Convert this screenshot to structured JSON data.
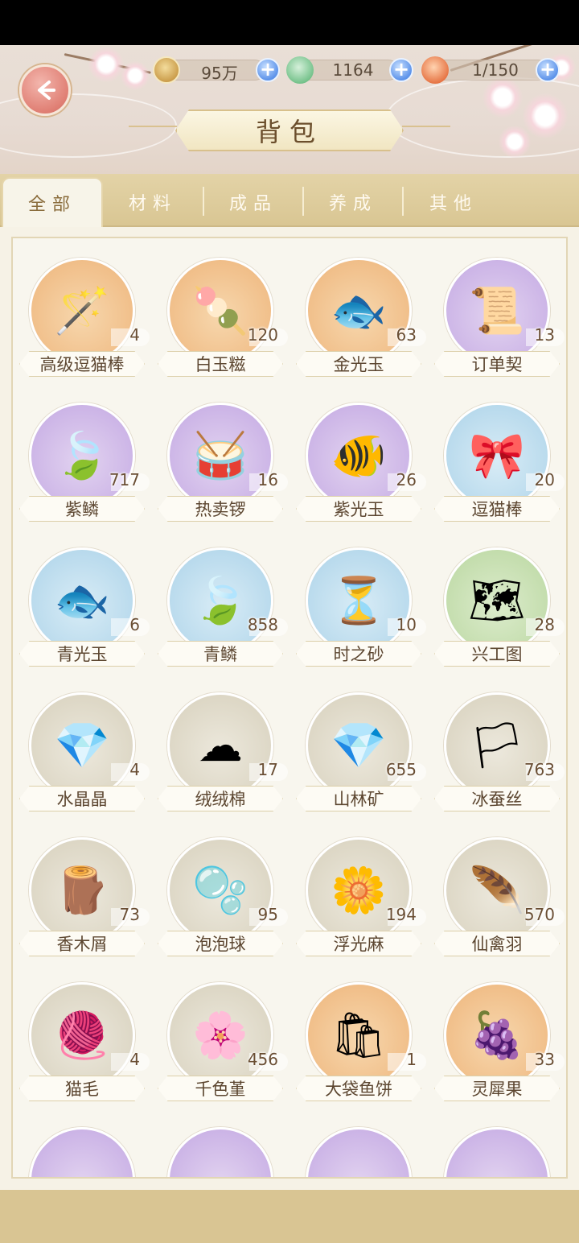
{
  "header": {
    "title": "背包",
    "resources": [
      {
        "name": "paw-coin",
        "value": "95万",
        "icon": "paw-coin-icon"
      },
      {
        "name": "jade",
        "value": "1164",
        "icon": "jade-icon"
      },
      {
        "name": "capacity",
        "value": "1/150",
        "icon": "bag-icon"
      }
    ],
    "plus_label": "+"
  },
  "tabs": [
    {
      "label": "全部",
      "active": true
    },
    {
      "label": "材料",
      "active": false
    },
    {
      "label": "成品",
      "active": false
    },
    {
      "label": "养成",
      "active": false
    },
    {
      "label": "其他",
      "active": false
    }
  ],
  "items": [
    {
      "name": "高级逗猫棒",
      "count": "4",
      "bg": "orange",
      "icon": "cat-teaser-icon",
      "glyph": "🪄"
    },
    {
      "name": "白玉糍",
      "count": "120",
      "bg": "orange",
      "icon": "rice-cake-icon",
      "glyph": "🍡"
    },
    {
      "name": "金光玉",
      "count": "63",
      "bg": "orange",
      "icon": "gold-jade-fish-icon",
      "glyph": "🐟"
    },
    {
      "name": "订单契",
      "count": "13",
      "bg": "purple",
      "icon": "contract-scroll-icon",
      "glyph": "📜"
    },
    {
      "name": "紫鳞",
      "count": "717",
      "bg": "purple",
      "icon": "purple-scale-icon",
      "glyph": "🍃"
    },
    {
      "name": "热卖锣",
      "count": "16",
      "bg": "purple",
      "icon": "gong-icon",
      "glyph": "🥁"
    },
    {
      "name": "紫光玉",
      "count": "26",
      "bg": "purple",
      "icon": "purple-jade-fish-icon",
      "glyph": "🐠"
    },
    {
      "name": "逗猫棒",
      "count": "20",
      "bg": "blue",
      "icon": "feather-wand-icon",
      "glyph": "🎀"
    },
    {
      "name": "青光玉",
      "count": "6",
      "bg": "blue",
      "icon": "cyan-jade-fish-icon",
      "glyph": "🐟"
    },
    {
      "name": "青鳞",
      "count": "858",
      "bg": "blue",
      "icon": "green-scale-icon",
      "glyph": "🍃"
    },
    {
      "name": "时之砂",
      "count": "10",
      "bg": "blue",
      "icon": "hourglass-icon",
      "glyph": "⏳"
    },
    {
      "name": "兴工图",
      "count": "28",
      "bg": "green",
      "icon": "blueprint-scroll-icon",
      "glyph": "🗺"
    },
    {
      "name": "水晶晶",
      "count": "4",
      "bg": "grey",
      "icon": "crystal-icon",
      "glyph": "💎"
    },
    {
      "name": "绒绒棉",
      "count": "17",
      "bg": "grey",
      "icon": "cotton-icon",
      "glyph": "☁"
    },
    {
      "name": "山林矿",
      "count": "655",
      "bg": "grey",
      "icon": "ore-icon",
      "glyph": "💎"
    },
    {
      "name": "冰蚕丝",
      "count": "763",
      "bg": "grey",
      "icon": "silk-icon",
      "glyph": "🏳"
    },
    {
      "name": "香木屑",
      "count": "73",
      "bg": "grey",
      "icon": "wood-log-icon",
      "glyph": "🪵"
    },
    {
      "name": "泡泡球",
      "count": "95",
      "bg": "grey",
      "icon": "bubble-icon",
      "glyph": "🫧"
    },
    {
      "name": "浮光麻",
      "count": "194",
      "bg": "grey",
      "icon": "golden-flower-icon",
      "glyph": "🌼"
    },
    {
      "name": "仙禽羽",
      "count": "570",
      "bg": "grey",
      "icon": "feather-icon",
      "glyph": "🪶"
    },
    {
      "name": "猫毛",
      "count": "4",
      "bg": "grey",
      "icon": "cat-fur-icon",
      "glyph": "🧶"
    },
    {
      "name": "千色堇",
      "count": "456",
      "bg": "grey",
      "icon": "pansy-icon",
      "glyph": "🌸"
    },
    {
      "name": "大袋鱼饼",
      "count": "1",
      "bg": "orange",
      "icon": "fish-cracker-bag-icon",
      "glyph": "🛍"
    },
    {
      "name": "灵犀果",
      "count": "33",
      "bg": "orange",
      "icon": "golden-fruit-icon",
      "glyph": "🍇"
    },
    {
      "name": "",
      "count": "",
      "bg": "purple",
      "icon": "partial-item-icon",
      "glyph": ""
    },
    {
      "name": "",
      "count": "",
      "bg": "purple",
      "icon": "partial-item-icon",
      "glyph": ""
    },
    {
      "name": "",
      "count": "",
      "bg": "purple",
      "icon": "partial-item-icon",
      "glyph": ""
    },
    {
      "name": "",
      "count": "",
      "bg": "purple",
      "icon": "partial-item-icon",
      "glyph": ""
    }
  ]
}
